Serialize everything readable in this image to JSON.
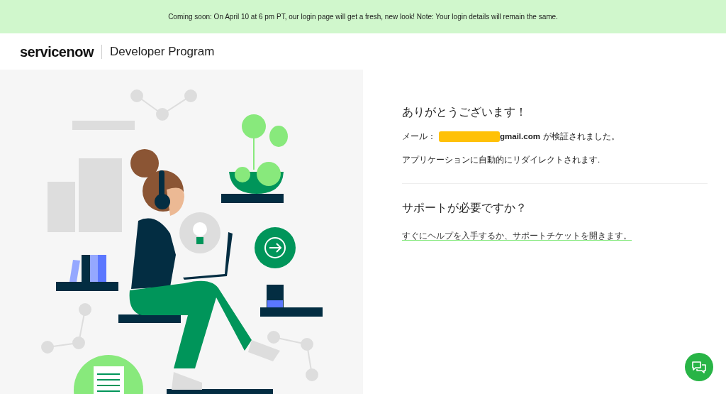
{
  "banner": {
    "text": "Coming soon: On April 10 at 6 pm PT, our login page will get a fresh, new look! Note: Your login details will remain the same."
  },
  "header": {
    "logo": "servicenow",
    "product": "Developer Program"
  },
  "confirmation": {
    "title": "ありがとうございます！",
    "email_label": "メール：",
    "email_visible": "gmail.com",
    "email_suffix": "が検証されました。",
    "email_redacted": true,
    "redirect_note": "アプリケーションに自動的にリダイレクトされます."
  },
  "support": {
    "title": "サポートが必要ですか？",
    "link": "すぐにヘルプを入手するか、サポートチケットを開きます。"
  }
}
